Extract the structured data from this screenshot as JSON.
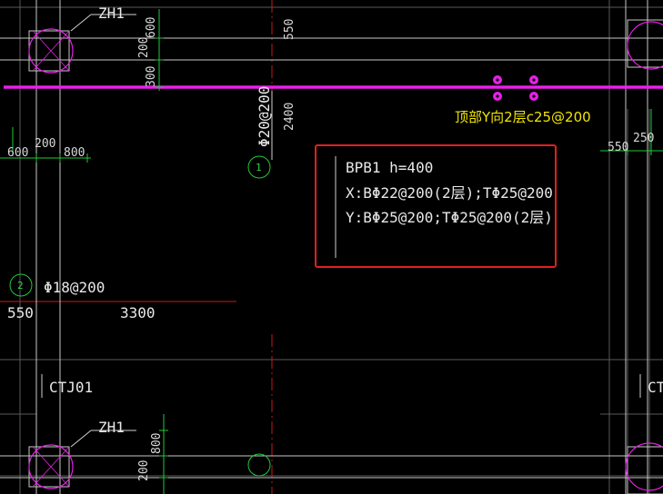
{
  "colors": {
    "background": "#000000",
    "grid_line": "#d0d0d0",
    "beam_outline": "#c8c8c8",
    "magenta_rebar": "#e820e8",
    "dim_green": "#22c83a",
    "axis_red": "#c81818",
    "annotation_yellow": "#f2e600",
    "highlight_box": "#e02020"
  },
  "labels": {
    "column_top": "ZH1",
    "column_bottom": "ZH1",
    "cap_left": "CTJ01",
    "cap_right": "CT",
    "top_rebar_note": "顶部Y向2层c25@200",
    "vertical_rebar": "Φ20@200",
    "horizontal_rebar": "Φ18@200",
    "axis_bubble_1": "1",
    "axis_bubble_2": "2"
  },
  "dimensions": {
    "d600_top": "600",
    "d200_top": "200",
    "d300": "300",
    "d550_top": "550",
    "d2400": "2400",
    "d600_left": "600",
    "d200_left": "200",
    "d800_left": "800",
    "d550_left": "550",
    "d3300": "3300",
    "d550_right": "550",
    "d250_right": "250",
    "d800_bottom": "800",
    "d200_bottom": "200"
  },
  "slab_note": {
    "line1": "BPB1 h=400",
    "line2": "X:BΦ22@200(2层);TΦ25@200",
    "line3": "Y:BΦ25@200;TΦ25@200(2层)"
  }
}
